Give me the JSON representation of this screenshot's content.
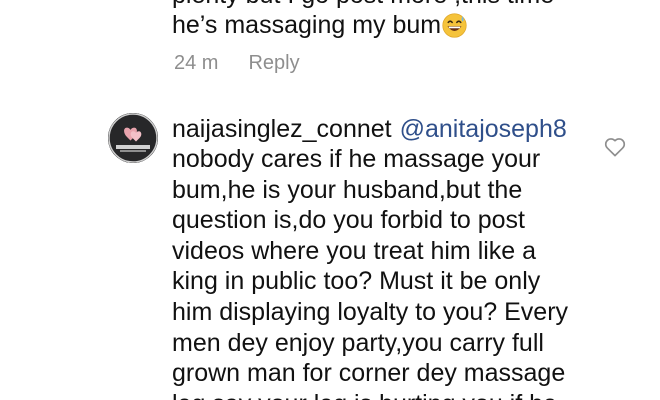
{
  "previous_comment": {
    "partial_line": "plenty but I go post more ,this time",
    "text": "he’s massaging my bum",
    "emoji": "grinning-sweat-emoji",
    "time": "24 m",
    "reply_label": "Reply"
  },
  "comment": {
    "username": "naijasinglez_connet",
    "mention": "@anitajoseph8",
    "lines": [
      "nobody cares if he massage your",
      "bum,he is your husband,but the",
      "question is,do you forbid to post",
      "videos where you treat him like a",
      "king in public too? Must it be only",
      "him displaying loyalty to you? Every",
      "men dey enjoy party,you carry full",
      "grown man for corner dey massage",
      "leg say your leg is hurting you.if he"
    ],
    "like_icon": "heart-outline-icon"
  },
  "avatar_logo_text": "NAIJA SINGLEZ CONNECT",
  "colors": {
    "text": "#111111",
    "muted": "#8e8e8e",
    "mention": "#2f4f8a",
    "avatar_bg": "#272729",
    "avatar_heart": "#e8a3ad"
  }
}
